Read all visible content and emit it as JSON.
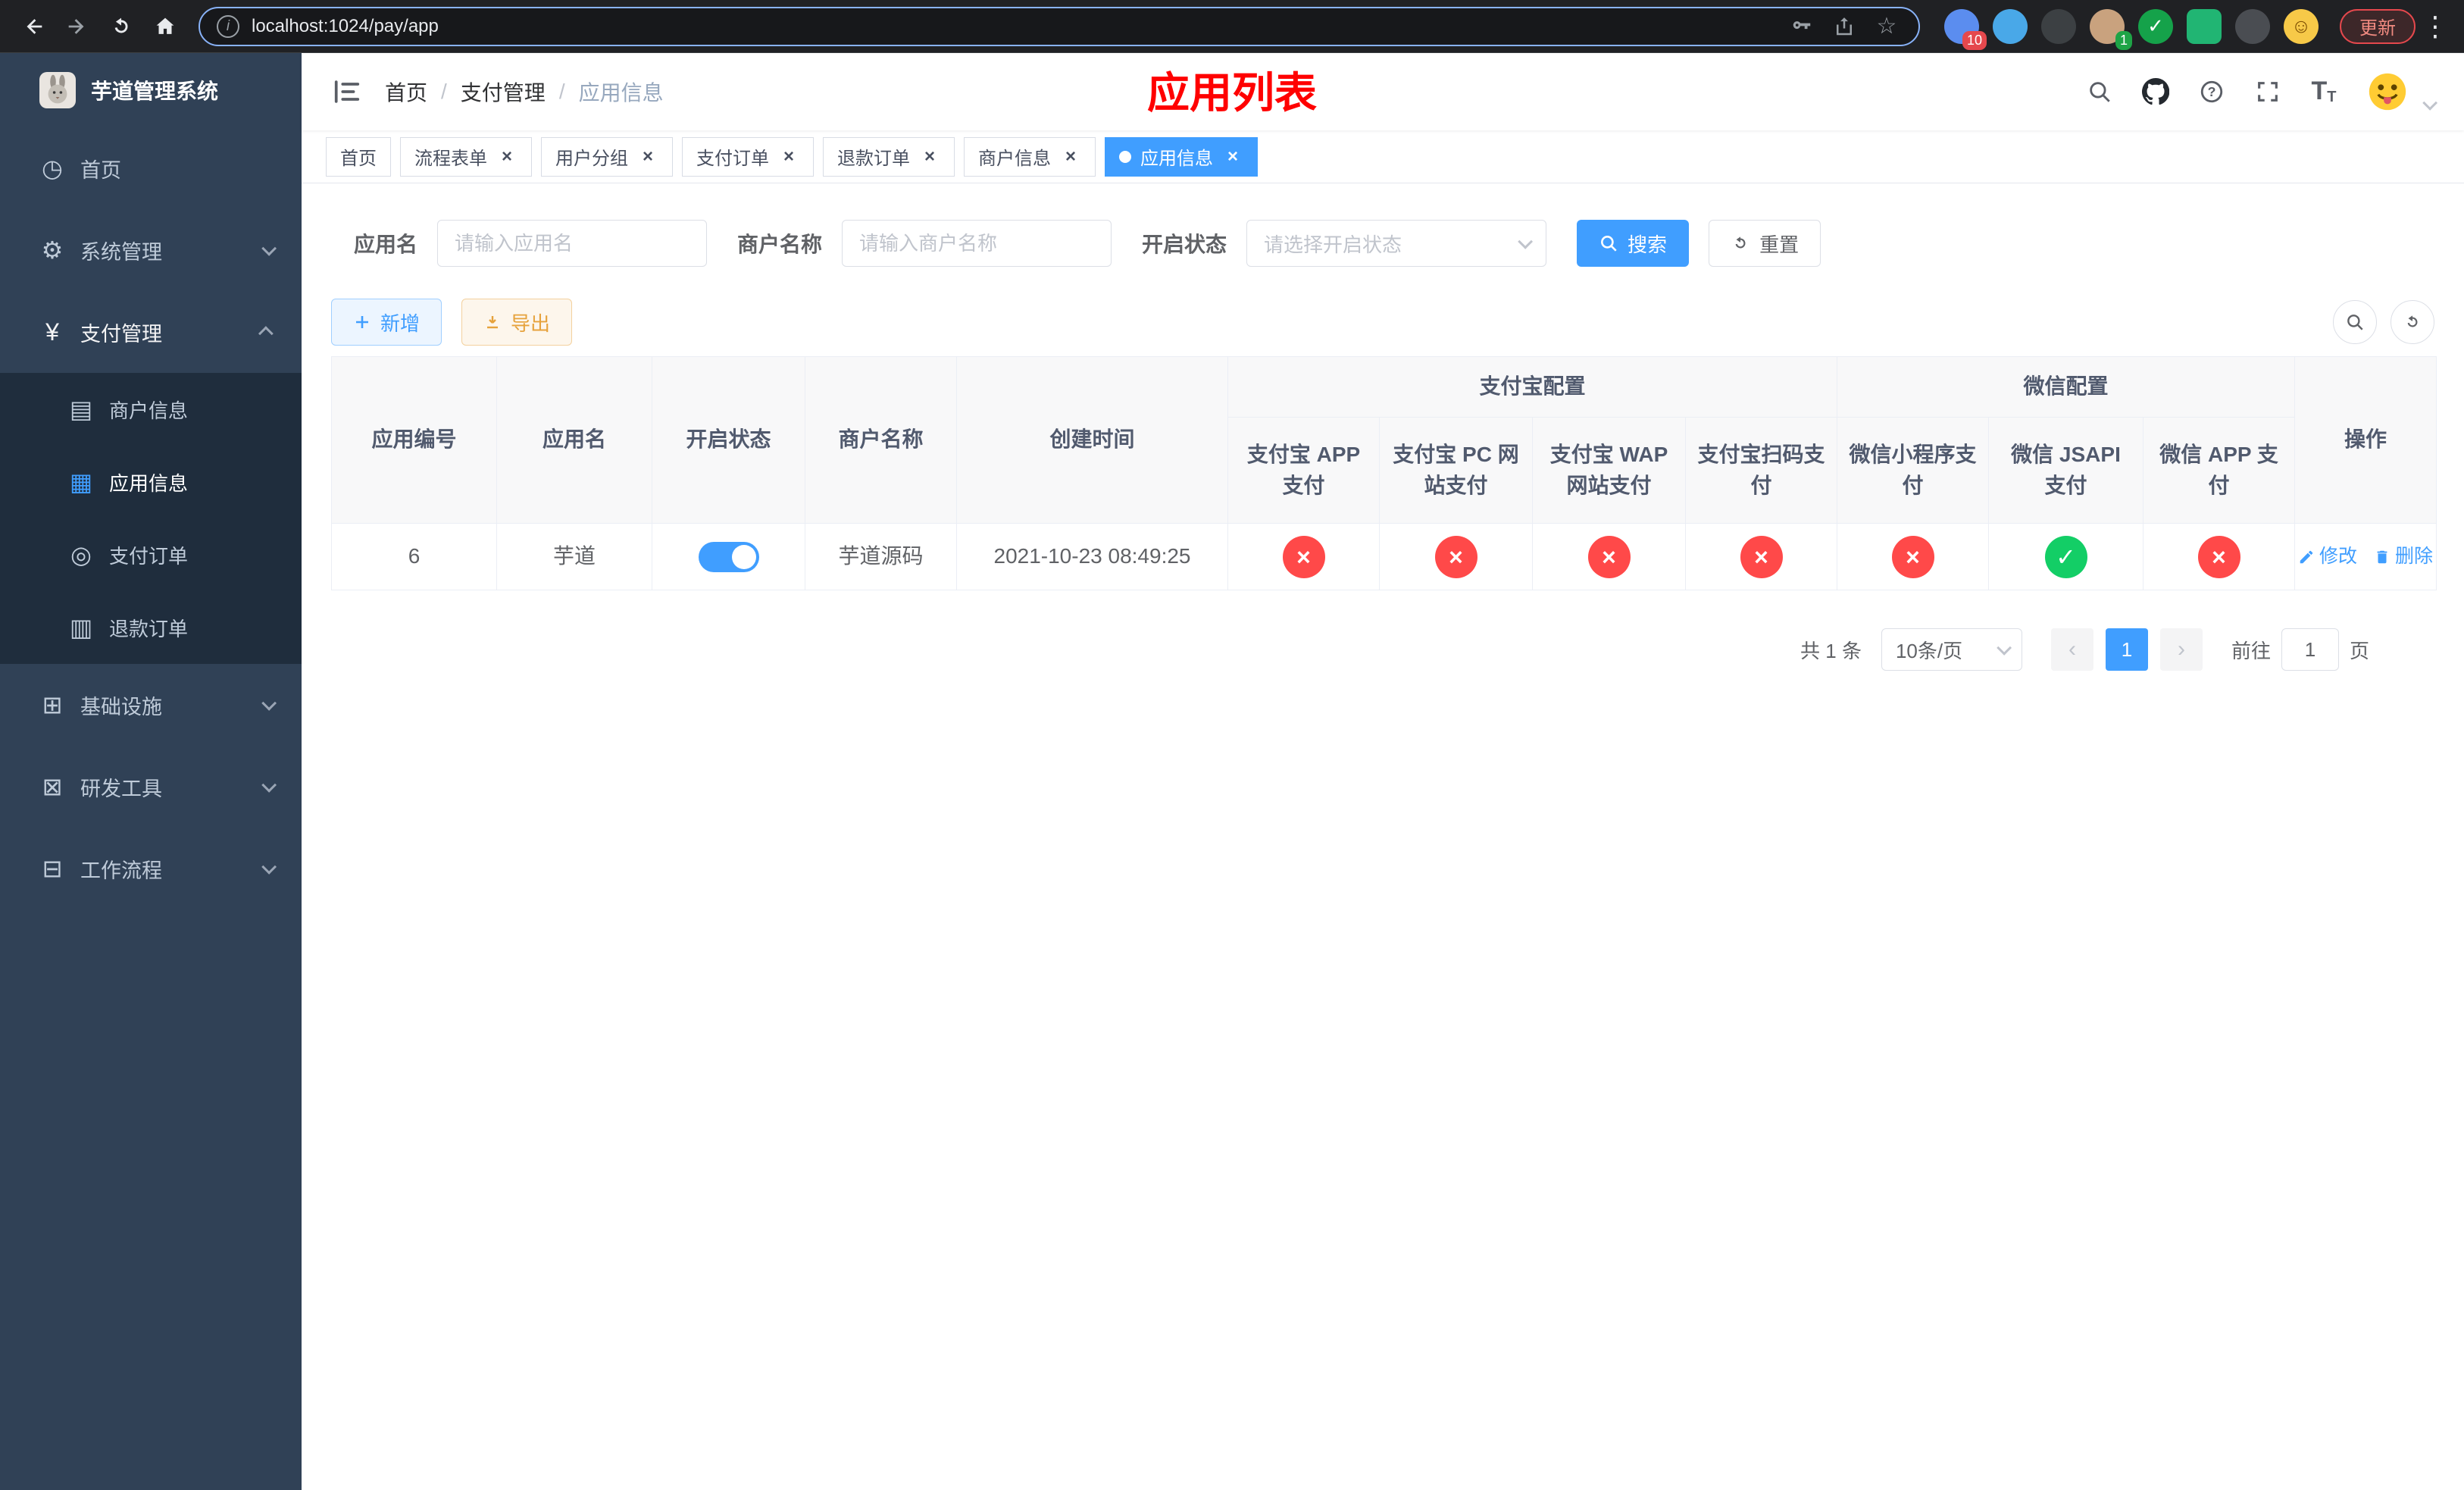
{
  "colors": {
    "primary": "#409eff",
    "success": "#13ce66",
    "danger": "#ff4949",
    "warning": "#e6a23c",
    "annotation": "#ff0000",
    "sidebar_bg": "#304156",
    "sidebar_submenu_bg": "#1f2d3d"
  },
  "browser": {
    "url": "localhost:1024/pay/app",
    "info_glyph": "i",
    "update_button": "更新",
    "extensions": [
      {
        "name": "blue-grid-extension-icon",
        "color": "#5b8def",
        "badge": "10",
        "badge_color": "red"
      },
      {
        "name": "blue-gem-extension-icon",
        "color": "#49a8e8"
      },
      {
        "name": "dark-circle-extension-icon",
        "color": "#3c4043"
      },
      {
        "name": "avatar-extension-icon",
        "color": "#c9a27e",
        "badge": "1",
        "badge_color": "green"
      },
      {
        "name": "green-check-extension-icon",
        "color": "#15a24a",
        "glyph": "✓"
      },
      {
        "name": "green-chat-extension-icon",
        "color": "#21b573",
        "shape": "square"
      },
      {
        "name": "pinwheel-extension-icon",
        "color": "#4a4d52"
      },
      {
        "name": "smiley-extension-icon",
        "color": "#f7c948",
        "glyph": "☺",
        "glyph_color": "#7a4b00"
      }
    ]
  },
  "sidebar": {
    "logo_title": "芋道管理系统",
    "items": [
      {
        "label": "首页",
        "glyph": "◷"
      },
      {
        "label": "系统管理",
        "glyph": "⚙",
        "expandable": true
      },
      {
        "label": "支付管理",
        "glyph": "¥",
        "expandable": true,
        "expanded": true
      },
      {
        "label": "商户信息",
        "glyph": "▤",
        "sub": true
      },
      {
        "label": "应用信息",
        "glyph": "▦",
        "sub": true,
        "active": true
      },
      {
        "label": "支付订单",
        "glyph": "◎",
        "sub": true
      },
      {
        "label": "退款订单",
        "glyph": "▥",
        "sub": true
      },
      {
        "label": "基础设施",
        "glyph": "⊞",
        "expandable": true
      },
      {
        "label": "研发工具",
        "glyph": "⊠",
        "expandable": true
      },
      {
        "label": "工作流程",
        "glyph": "⊟",
        "expandable": true
      }
    ]
  },
  "header": {
    "breadcrumb": [
      "首页",
      "支付管理",
      "应用信息"
    ],
    "separator": "/",
    "annotation": "应用列表"
  },
  "tabs": [
    {
      "label": "首页"
    },
    {
      "label": "流程表单",
      "closable": true
    },
    {
      "label": "用户分组",
      "closable": true
    },
    {
      "label": "支付订单",
      "closable": true
    },
    {
      "label": "退款订单",
      "closable": true
    },
    {
      "label": "商户信息",
      "closable": true
    },
    {
      "label": "应用信息",
      "closable": true,
      "active": true
    }
  ],
  "filters": {
    "app_name": {
      "label": "应用名",
      "placeholder": "请输入应用名",
      "value": ""
    },
    "merchant_name": {
      "label": "商户名称",
      "placeholder": "请输入商户名称",
      "value": ""
    },
    "status": {
      "label": "开启状态",
      "placeholder": "请选择开启状态",
      "value": ""
    },
    "search_button": "搜索",
    "reset_button": "重置"
  },
  "toolbar": {
    "add_button": "新增",
    "export_button": "导出"
  },
  "table": {
    "merged_columns": [
      "应用编号",
      "应用名",
      "开启状态",
      "商户名称",
      "创建时间"
    ],
    "alipay_group": "支付宝配置",
    "wechat_group": "微信配置",
    "alipay_columns": [
      "支付宝 APP 支付",
      "支付宝 PC 网站支付",
      "支付宝 WAP 网站支付",
      "支付宝扫码支付"
    ],
    "wechat_columns": [
      "微信小程序支付",
      "微信 JSAPI 支付",
      "微信 APP 支付"
    ],
    "actions_column": "操作",
    "rows": [
      {
        "id": "6",
        "name": "芋道",
        "enabled": true,
        "merchant": "芋道源码",
        "created": "2021-10-23 08:49:25",
        "channels": [
          false,
          false,
          false,
          false,
          false,
          true,
          false
        ],
        "edit_label": "修改",
        "delete_label": "删除"
      }
    ]
  },
  "pagination": {
    "total": "共 1 条",
    "page_size": "10条/页",
    "prev": "‹",
    "next": "›",
    "current_page": "1",
    "goto_label": "前往",
    "goto_value": "1",
    "goto_suffix": "页"
  },
  "ui": {
    "close": "×",
    "check": "✓",
    "cross": "×",
    "kebab": "⋮",
    "star": "☆",
    "text_icon_big": "T",
    "text_icon_small": "T"
  }
}
